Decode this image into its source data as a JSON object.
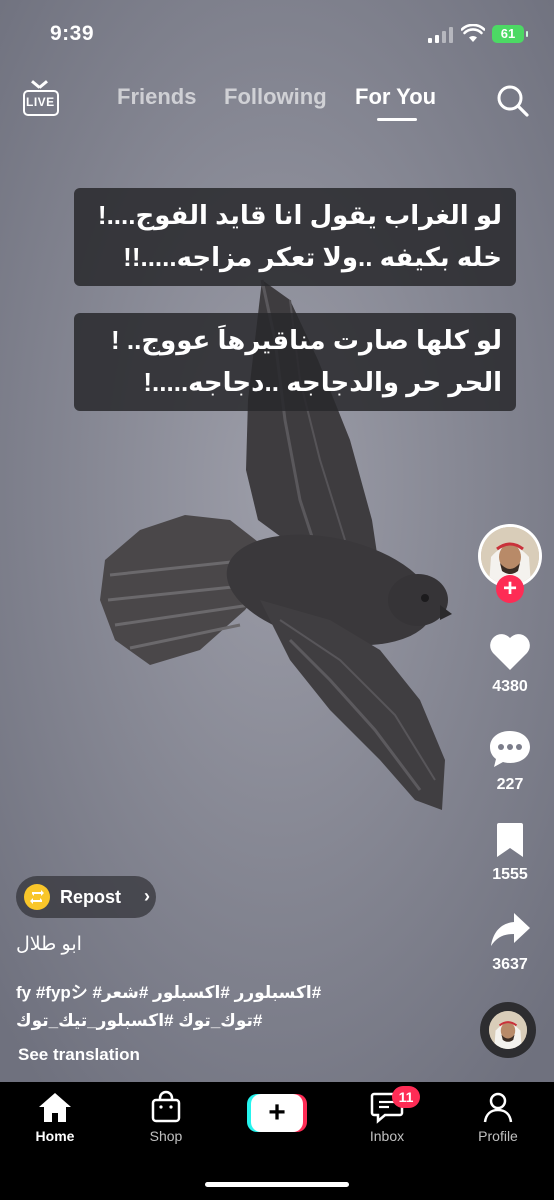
{
  "status_bar": {
    "time": "9:39",
    "battery": "61"
  },
  "top_nav": {
    "live_label": "LIVE",
    "tabs": [
      {
        "label": "Friends",
        "active": false
      },
      {
        "label": "Following",
        "active": false
      },
      {
        "label": "For You",
        "active": true
      }
    ]
  },
  "overlay": {
    "box1": [
      "لو الغراب يقول انا قايد الفوج....!",
      "خله بكيفه ..ولا تعكر مزاجه.....!!"
    ],
    "box2": [
      "لو كلها صارت مناقيرهاَ عووج.. !",
      "الحر حر والدجاجه ..دجاجه.....!"
    ]
  },
  "right_rail": {
    "likes": "4380",
    "comments": "227",
    "saves": "1555",
    "shares": "3637"
  },
  "post": {
    "repost_label": "Repost",
    "author": "ابو طلال",
    "hashtags_line1": "fy #fypシ #اكسبلورر #اكسبلور #شعر#",
    "hashtags_line2": "#توك_توك #اكسبلور_تيك_توك",
    "see_translation": "See translation"
  },
  "bottom_nav": {
    "items": [
      {
        "label": "Home",
        "active": true
      },
      {
        "label": "Shop",
        "active": false
      },
      {
        "label": "Inbox",
        "active": false,
        "badge": "11"
      },
      {
        "label": "Profile",
        "active": false
      }
    ]
  },
  "colors": {
    "accent": "#fe2c55",
    "cyan": "#25f4ee",
    "battery": "#4cd964",
    "repost": "#f9c62a"
  }
}
